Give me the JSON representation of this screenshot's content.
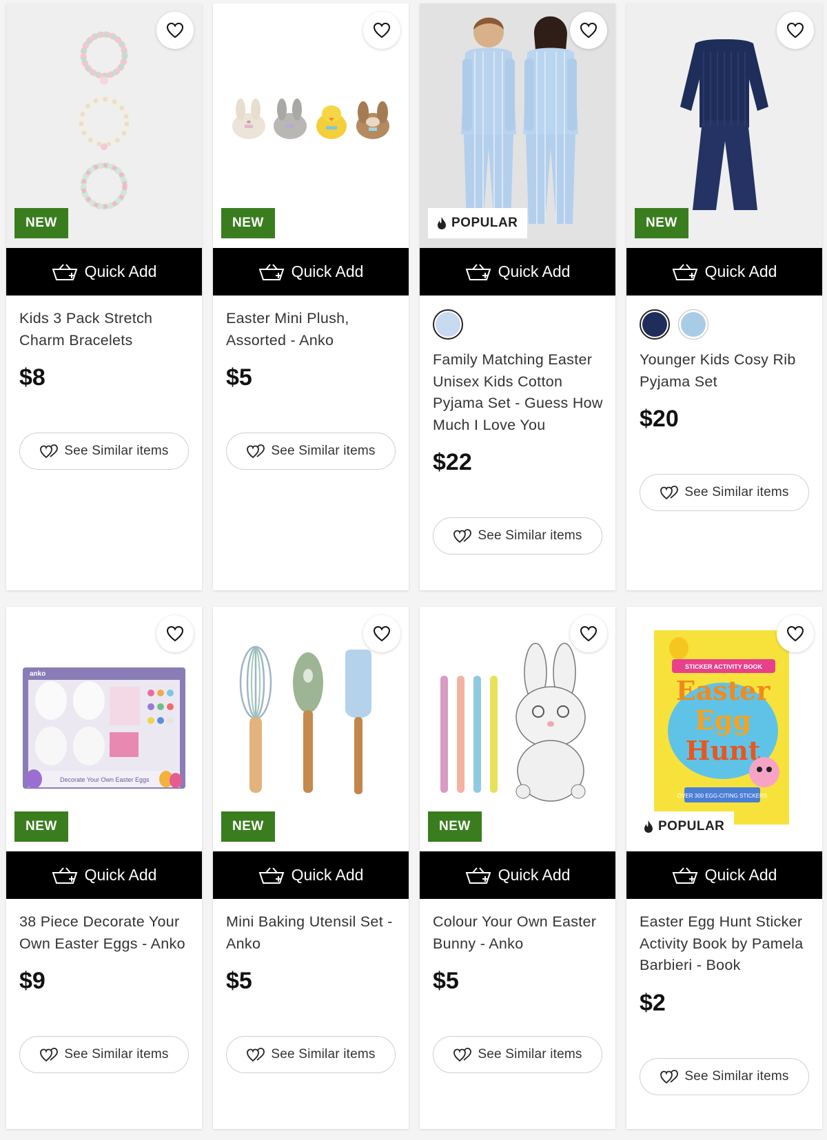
{
  "common": {
    "quick_add_label": "Quick Add",
    "see_similar_label": "See Similar items"
  },
  "badges": {
    "new": "NEW",
    "popular": "POPULAR"
  },
  "colors": {
    "new_badge": "#3a7d1f",
    "quick_add_bg": "#000000"
  },
  "products": [
    {
      "title": "Kids 3 Pack Stretch Charm Bracelets",
      "price": "$8",
      "badge": "NEW",
      "image": "bracelets"
    },
    {
      "title": "Easter Mini Plush, Assorted - Anko",
      "price": "$5",
      "badge": "NEW",
      "image": "plush"
    },
    {
      "title": "Family Matching Easter Unisex Kids Cotton Pyjama Set - Guess How Much I Love You",
      "price": "$22",
      "badge": "POPULAR",
      "image": "kids-pyjamas",
      "swatches": [
        "light-blue-print"
      ]
    },
    {
      "title": "Younger Kids Cosy Rib Pyjama Set",
      "price": "$20",
      "badge": "NEW",
      "image": "navy-pyjamas",
      "swatches": [
        "navy",
        "light-blue"
      ]
    },
    {
      "title": "38 Piece Decorate Your Own Easter Eggs - Anko",
      "price": "$9",
      "badge": "NEW",
      "image": "egg-kit"
    },
    {
      "title": "Mini Baking Utensil Set - Anko",
      "price": "$5",
      "badge": "NEW",
      "image": "utensils"
    },
    {
      "title": "Colour Your Own Easter Bunny - Anko",
      "price": "$5",
      "badge": "NEW",
      "image": "colour-bunny"
    },
    {
      "title": "Easter Egg Hunt Sticker Activity Book by Pamela Barbieri - Book",
      "price": "$2",
      "badge": "POPULAR",
      "image": "activity-book"
    }
  ],
  "image_text": {
    "egg_kit_brand": "anko",
    "egg_kit_caption": "Decorate Your Own Easter Eggs",
    "book_title_1": "Easter",
    "book_title_2": "Egg",
    "book_title_3": "Hunt",
    "book_banner": "STICKER ACTIVITY BOOK",
    "book_stickers": "OVER 300 EGG-CITING STICKERS"
  }
}
